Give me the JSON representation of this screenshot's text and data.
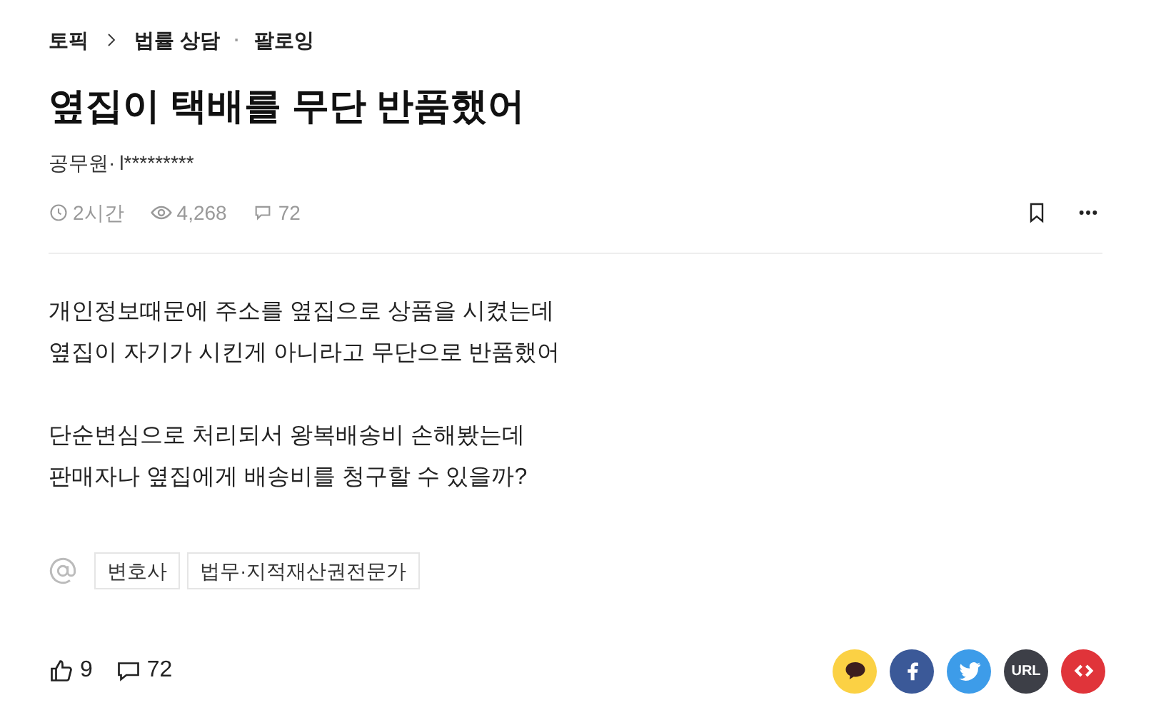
{
  "breadcrumb": {
    "topic": "토픽",
    "category": "법률 상담",
    "separator": "·",
    "follow": "팔로잉"
  },
  "title": "옆집이 택배를 무단 반품했어",
  "author": {
    "job": "공무원·",
    "name": "l*********"
  },
  "meta": {
    "time": "2시간",
    "views": "4,268",
    "comments": "72"
  },
  "body": [
    [
      "개인정보때문에 주소를 옆집으로 상품을 시켰는데",
      "옆집이 자기가 시킨게 아니라고 무단으로 반품했어"
    ],
    [
      "단순변심으로 처리되서 왕복배송비 손해봤는데",
      "판매자나 옆집에게 배송비를 청구할 수 있을까?"
    ]
  ],
  "mentions": [
    "변호사",
    "법무·지적재산권전문가"
  ],
  "footer": {
    "likes": "9",
    "comments": "72"
  },
  "share": [
    {
      "kind": "kakao"
    },
    {
      "kind": "facebook"
    },
    {
      "kind": "twitter"
    },
    {
      "kind": "url",
      "label": "URL"
    },
    {
      "kind": "embed"
    }
  ]
}
